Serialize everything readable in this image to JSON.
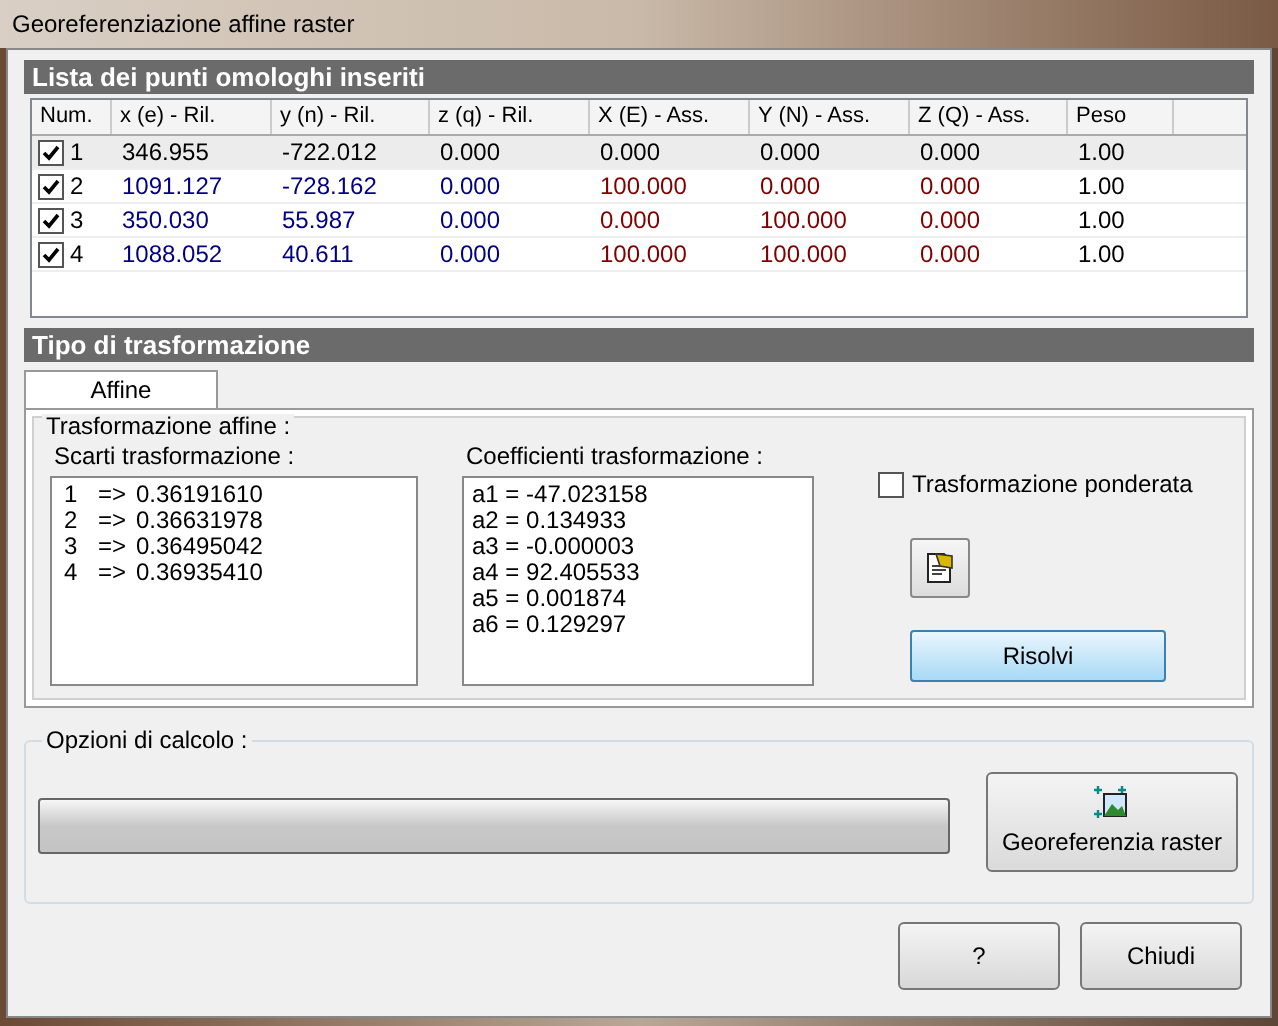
{
  "window": {
    "title": "Georeferenziazione affine raster"
  },
  "points": {
    "title": "Lista dei punti omologhi inseriti",
    "columns": [
      "Num.",
      "x (e) - Ril.",
      "y (n) - Ril.",
      "z (q) - Ril.",
      "X (E) - Ass.",
      "Y (N) - Ass.",
      "Z (Q) - Ass.",
      "Peso"
    ],
    "rows": [
      {
        "selected": true,
        "checked": true,
        "cells": [
          {
            "text": "1",
            "color": "#000000"
          },
          {
            "text": "346.955",
            "color": "#000000"
          },
          {
            "text": "-722.012",
            "color": "#000000"
          },
          {
            "text": "0.000",
            "color": "#000000"
          },
          {
            "text": "0.000",
            "color": "#000000"
          },
          {
            "text": "0.000",
            "color": "#000000"
          },
          {
            "text": "0.000",
            "color": "#000000"
          },
          {
            "text": "1.00",
            "color": "#000000"
          }
        ]
      },
      {
        "selected": false,
        "checked": true,
        "cells": [
          {
            "text": "2",
            "color": "#000000"
          },
          {
            "text": "1091.127",
            "color": "#000080"
          },
          {
            "text": "-728.162",
            "color": "#000080"
          },
          {
            "text": "0.000",
            "color": "#000080"
          },
          {
            "text": "100.000",
            "color": "#800000"
          },
          {
            "text": "0.000",
            "color": "#800000"
          },
          {
            "text": "0.000",
            "color": "#800000"
          },
          {
            "text": "1.00",
            "color": "#000000"
          }
        ]
      },
      {
        "selected": false,
        "checked": true,
        "cells": [
          {
            "text": "3",
            "color": "#000000"
          },
          {
            "text": "350.030",
            "color": "#000080"
          },
          {
            "text": "55.987",
            "color": "#000080"
          },
          {
            "text": "0.000",
            "color": "#000080"
          },
          {
            "text": "0.000",
            "color": "#800000"
          },
          {
            "text": "100.000",
            "color": "#800000"
          },
          {
            "text": "0.000",
            "color": "#800000"
          },
          {
            "text": "1.00",
            "color": "#000000"
          }
        ]
      },
      {
        "selected": false,
        "checked": true,
        "cells": [
          {
            "text": "4",
            "color": "#000000"
          },
          {
            "text": "1088.052",
            "color": "#000080"
          },
          {
            "text": "40.611",
            "color": "#000080"
          },
          {
            "text": "0.000",
            "color": "#000080"
          },
          {
            "text": "100.000",
            "color": "#800000"
          },
          {
            "text": "100.000",
            "color": "#800000"
          },
          {
            "text": "0.000",
            "color": "#800000"
          },
          {
            "text": "1.00",
            "color": "#000000"
          }
        ]
      }
    ]
  },
  "transform": {
    "title": "Tipo di trasformazione",
    "tabs": [
      {
        "label": "Affine",
        "selected": true
      }
    ],
    "group_title": "Trasformazione affine :",
    "residuals": {
      "label": "Scarti trasformazione :",
      "items": [
        {
          "index": "1",
          "arrow": "=>",
          "value": "0.36191610"
        },
        {
          "index": "2",
          "arrow": "=>",
          "value": "0.36631978"
        },
        {
          "index": "3",
          "arrow": "=>",
          "value": "0.36495042"
        },
        {
          "index": "4",
          "arrow": "=>",
          "value": "0.36935410"
        }
      ]
    },
    "coefficients": {
      "label": "Coefficienti trasformazione :",
      "items": [
        "a1 = -47.023158",
        "a2 = 0.134933",
        "a3 = -0.000003",
        "a4 = 92.405533",
        "a5 = 0.001874",
        "a6 = 0.129297"
      ]
    },
    "weighted": {
      "label": "Trasformazione ponderata",
      "checked": false
    },
    "solve_button": "Risolvi"
  },
  "options": {
    "title": "Opzioni di calcolo :",
    "progress": {
      "level": 0
    },
    "georef_button": "Georeferenzia raster"
  },
  "buttons": [
    "?",
    "Chiudi"
  ]
}
